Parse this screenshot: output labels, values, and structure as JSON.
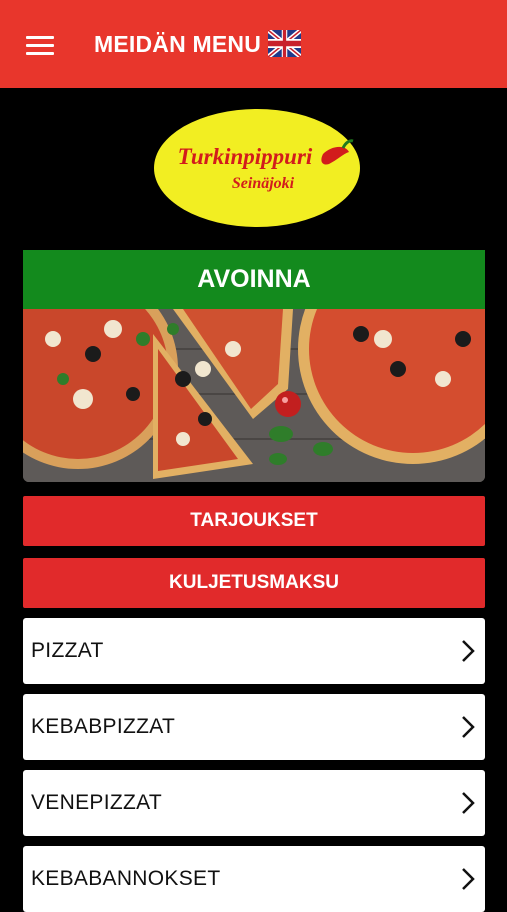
{
  "header": {
    "title": "MEIDÄN MENU",
    "menu_icon": "hamburger-menu-icon",
    "language_icon": "uk-flag-icon",
    "background": "#e8362c"
  },
  "logo": {
    "line1": "Turkinpippuri",
    "line2": "Seinäjoki",
    "background": "#f2ee22",
    "text_color": "#d21c1c"
  },
  "status": {
    "label": "AVOINNA",
    "color": "#138a1d"
  },
  "hero": {
    "image": "pizza-photo"
  },
  "buttons": {
    "offers": "TARJOUKSET",
    "delivery": "KULJETUSMAKSU",
    "color": "#e12a2b"
  },
  "categories": [
    {
      "label": "PIZZAT"
    },
    {
      "label": "KEBABPIZZAT"
    },
    {
      "label": "VENEPIZZAT"
    },
    {
      "label": "KEBABANNOKSET"
    }
  ]
}
